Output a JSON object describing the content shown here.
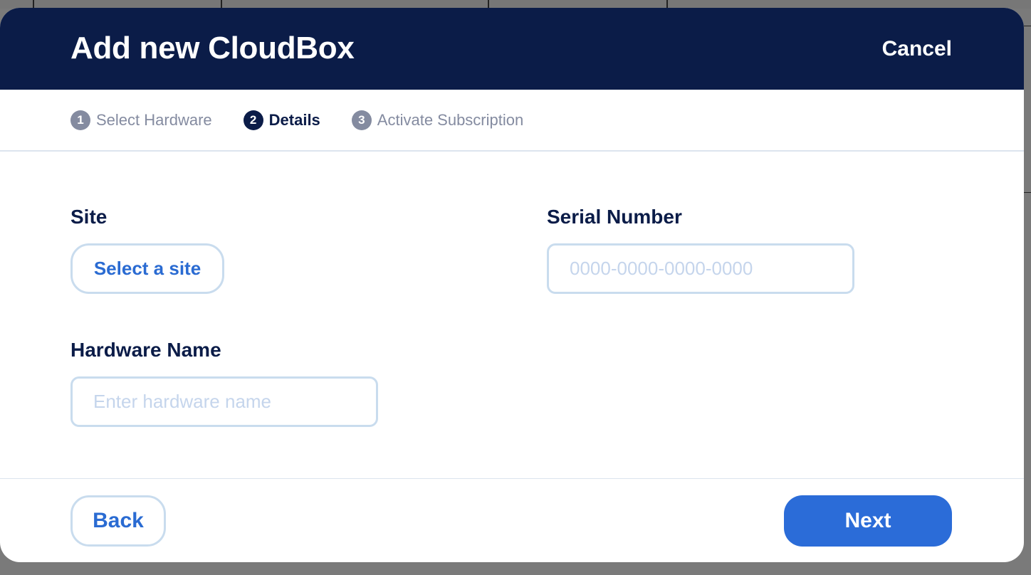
{
  "modal": {
    "title": "Add new CloudBox",
    "cancel_label": "Cancel"
  },
  "stepper": {
    "steps": [
      {
        "number": "1",
        "label": "Select Hardware",
        "active": false
      },
      {
        "number": "2",
        "label": "Details",
        "active": true
      },
      {
        "number": "3",
        "label": "Activate Subscription",
        "active": false
      }
    ]
  },
  "form": {
    "site": {
      "label": "Site",
      "button_label": "Select a site"
    },
    "serial_number": {
      "label": "Serial Number",
      "placeholder": "0000-0000-0000-0000",
      "value": ""
    },
    "hardware_name": {
      "label": "Hardware Name",
      "placeholder": "Enter hardware name",
      "value": ""
    }
  },
  "footer": {
    "back_label": "Back",
    "next_label": "Next"
  },
  "colors": {
    "header_bg": "#0b1c48",
    "accent": "#2b6cd8",
    "inactive_step": "#848ba0",
    "input_border": "#c9dcee"
  }
}
